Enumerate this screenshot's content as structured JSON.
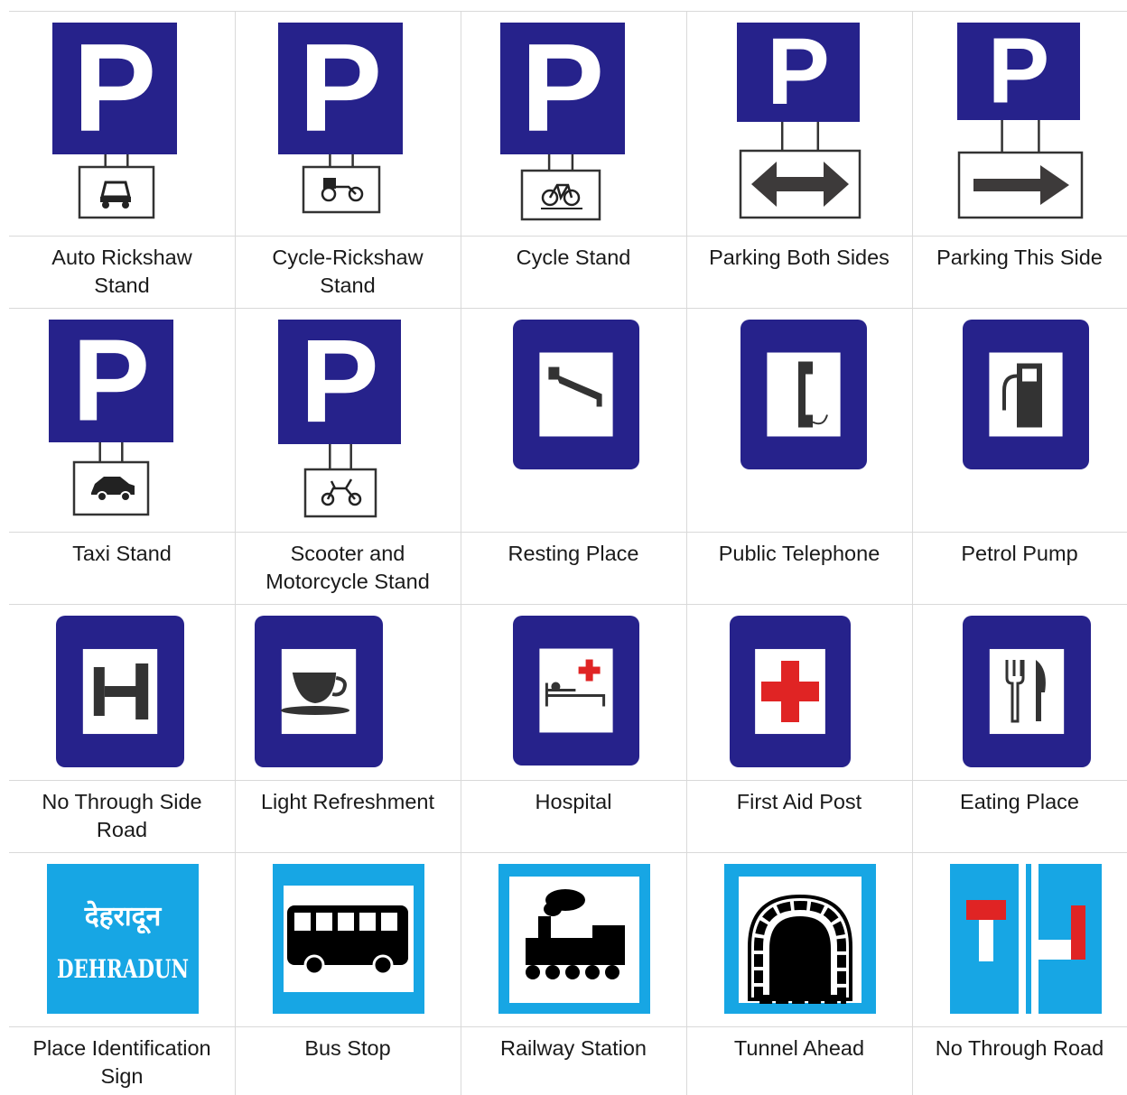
{
  "colors": {
    "navy": "#26228b",
    "cyan": "#17a6e4",
    "red": "#e02424",
    "dark_grey": "#3d3a3a"
  },
  "signs": [
    {
      "label": "Auto Rickshaw\nStand",
      "icon": "parking-auto-rickshaw-icon"
    },
    {
      "label": "Cycle-Rickshaw\nStand",
      "icon": "parking-cycle-rickshaw-icon"
    },
    {
      "label": "Cycle Stand",
      "icon": "parking-cycle-icon"
    },
    {
      "label": "Parking Both Sides",
      "icon": "parking-both-sides-icon"
    },
    {
      "label": "Parking This Side",
      "icon": "parking-this-side-icon"
    },
    {
      "label": "Taxi Stand",
      "icon": "parking-taxi-icon"
    },
    {
      "label": "Scooter and\nMotorcycle Stand",
      "icon": "parking-scooter-icon"
    },
    {
      "label": "Resting Place",
      "icon": "bed-icon"
    },
    {
      "label": "Public Telephone",
      "icon": "telephone-icon"
    },
    {
      "label": "Petrol Pump",
      "icon": "fuel-pump-icon"
    },
    {
      "label": "No Through Side\nRoad",
      "icon": "no-through-side-road-icon"
    },
    {
      "label": "Light Refreshment",
      "icon": "teacup-icon"
    },
    {
      "label": "Hospital",
      "icon": "hospital-bed-icon"
    },
    {
      "label": "First Aid Post",
      "icon": "red-cross-icon"
    },
    {
      "label": "Eating Place",
      "icon": "fork-knife-icon"
    },
    {
      "label": "Place Identification\nSign",
      "icon": "place-name-board-icon",
      "text_hi": "देहरादून",
      "text_en": "DEHRADUN"
    },
    {
      "label": "Bus Stop",
      "icon": "bus-icon"
    },
    {
      "label": "Railway Station",
      "icon": "steam-locomotive-icon"
    },
    {
      "label": "Tunnel Ahead",
      "icon": "tunnel-icon"
    },
    {
      "label": "No Through Road",
      "icon": "no-through-road-icon"
    }
  ]
}
